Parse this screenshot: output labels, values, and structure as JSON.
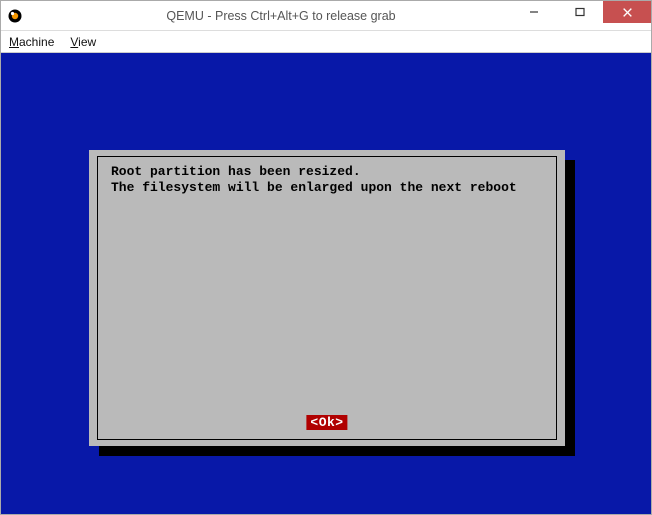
{
  "window": {
    "title": "QEMU - Press Ctrl+Alt+G to release grab"
  },
  "menubar": {
    "items": [
      {
        "label": "Machine",
        "mnemonic_index": 0
      },
      {
        "label": "View",
        "mnemonic_index": 0
      }
    ]
  },
  "dialog": {
    "line1": "Root partition has been resized.",
    "line2": "The filesystem will be enlarged upon the next reboot",
    "ok_label": "<Ok>"
  },
  "colors": {
    "console_bg": "#0818a8",
    "dialog_bg": "#bababa",
    "ok_bg": "#b00000",
    "close_bg": "#c75050"
  }
}
